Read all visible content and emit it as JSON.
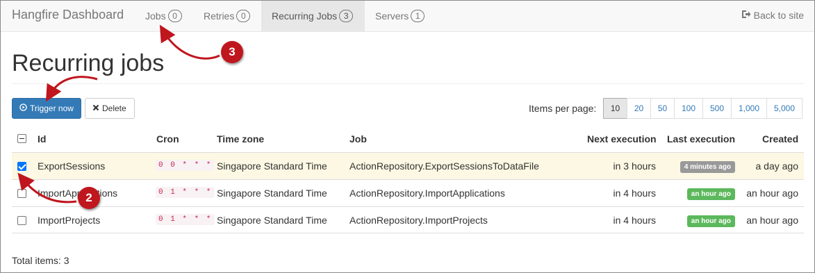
{
  "navbar": {
    "brand": "Hangfire Dashboard",
    "items": [
      {
        "label": "Jobs",
        "count": "0"
      },
      {
        "label": "Retries",
        "count": "0"
      },
      {
        "label": "Recurring Jobs",
        "count": "3"
      },
      {
        "label": "Servers",
        "count": "1"
      }
    ],
    "back_label": "Back to site",
    "back_icon": "sign-out-icon"
  },
  "page": {
    "title": "Recurring jobs"
  },
  "toolbar": {
    "trigger_label": "Trigger now",
    "trigger_icon": "play-circle-icon",
    "delete_label": "Delete",
    "delete_icon": "remove-icon",
    "items_per_page_label": "Items per page:",
    "page_sizes": [
      "10",
      "20",
      "50",
      "100",
      "500",
      "1,000",
      "5,000"
    ],
    "page_size_selected": "10"
  },
  "table": {
    "headers": {
      "id": "Id",
      "cron": "Cron",
      "timezone": "Time zone",
      "job": "Job",
      "next": "Next execution",
      "last": "Last execution",
      "created": "Created"
    },
    "rows": [
      {
        "checked": true,
        "id": "ExportSessions",
        "cron": "0 0 * * *",
        "timezone": "Singapore Standard Time",
        "job": "ActionRepository.ExportSessionsToDataFile",
        "next": "in 3 hours",
        "last": "4 minutes ago",
        "last_color": "#999999",
        "created": "a day ago"
      },
      {
        "checked": false,
        "id": "ImportApplications",
        "cron": "0 1 * * *",
        "timezone": "Singapore Standard Time",
        "job": "ActionRepository.ImportApplications",
        "next": "in 4 hours",
        "last": "an hour ago",
        "last_color": "#5cb85c",
        "created": "an hour ago"
      },
      {
        "checked": false,
        "id": "ImportProjects",
        "cron": "0 1 * * *",
        "timezone": "Singapore Standard Time",
        "job": "ActionRepository.ImportProjects",
        "next": "in 4 hours",
        "last": "an hour ago",
        "last_color": "#5cb85c",
        "created": "an hour ago"
      }
    ]
  },
  "footer": {
    "total": "Total items: 3"
  },
  "annotations": {
    "markers": [
      "3",
      "2"
    ],
    "color": "#c0161e"
  },
  "colors": {
    "primary": "#337ab7",
    "selected_row": "#fcf8e3"
  }
}
